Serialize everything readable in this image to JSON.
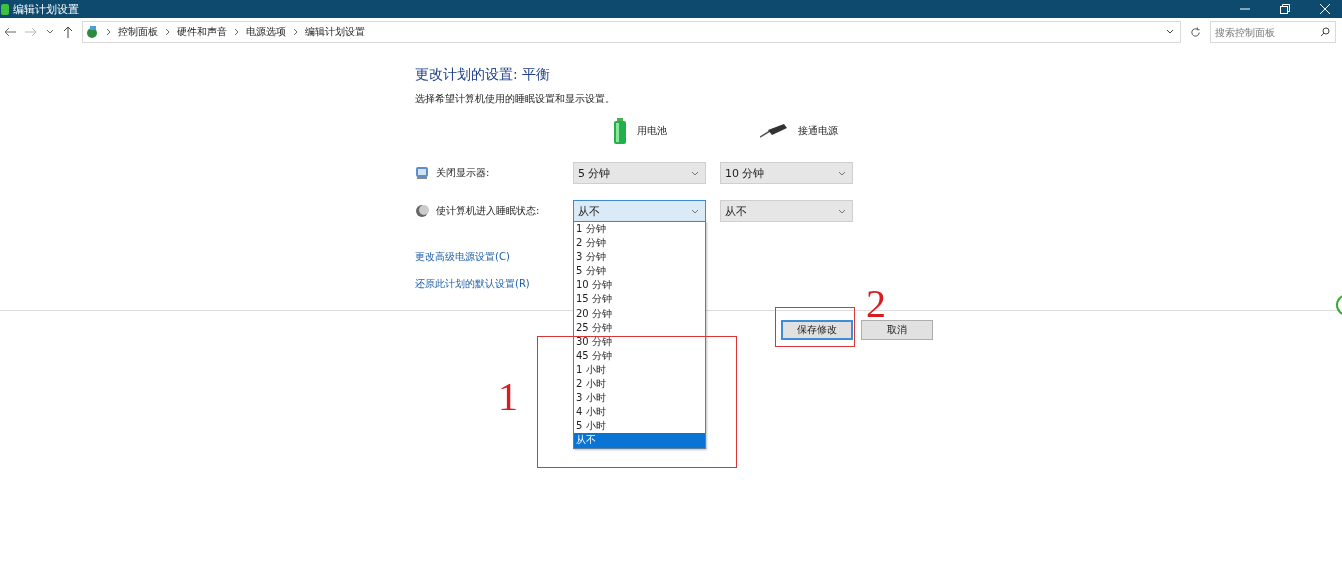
{
  "window": {
    "title": "编辑计划设置"
  },
  "address_bar": {
    "breadcrumbs": [
      "控制面板",
      "硬件和声音",
      "电源选项",
      "编辑计划设置"
    ]
  },
  "search": {
    "placeholder": "搜索控制面板"
  },
  "heading": "更改计划的设置: 平衡",
  "description": "选择希望计算机使用的睡眠设置和显示设置。",
  "columns": [
    {
      "label": "用电池",
      "kind": "battery"
    },
    {
      "label": "接通电源",
      "kind": "plug"
    }
  ],
  "settings": [
    {
      "label": "关闭显示器:",
      "kind": "display",
      "battery": "5 分钟",
      "plugged_in": "10 分钟",
      "expanded": false
    },
    {
      "label": "使计算机进入睡眠状态:",
      "kind": "sleep",
      "battery": "从不",
      "plugged_in": "从不",
      "expanded": true
    }
  ],
  "dropdown_options": [
    {
      "label": "1 分钟",
      "selected": false
    },
    {
      "label": "2 分钟",
      "selected": false
    },
    {
      "label": "3 分钟",
      "selected": false
    },
    {
      "label": "5 分钟",
      "selected": false
    },
    {
      "label": "10 分钟",
      "selected": false
    },
    {
      "label": "15 分钟",
      "selected": false
    },
    {
      "label": "20 分钟",
      "selected": false
    },
    {
      "label": "25 分钟",
      "selected": false
    },
    {
      "label": "30 分钟",
      "selected": false
    },
    {
      "label": "45 分钟",
      "selected": false
    },
    {
      "label": "1 小时",
      "selected": false
    },
    {
      "label": "2 小时",
      "selected": false
    },
    {
      "label": "3 小时",
      "selected": false
    },
    {
      "label": "4 小时",
      "selected": false
    },
    {
      "label": "5 小时",
      "selected": false
    },
    {
      "label": "从不",
      "selected": true
    }
  ],
  "links": [
    "更改高级电源设置(C)",
    "还原此计划的默认设置(R)"
  ],
  "buttons": [
    {
      "label": "保存修改",
      "default": true
    },
    {
      "label": "取消",
      "default": false
    }
  ],
  "annotations": [
    {
      "label": "1"
    },
    {
      "label": "2"
    }
  ]
}
